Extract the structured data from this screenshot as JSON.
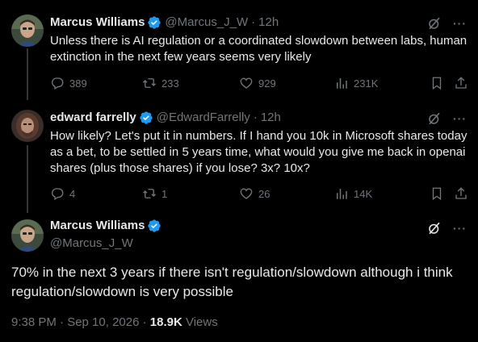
{
  "tweets": [
    {
      "name": "Marcus Williams",
      "handle": "@Marcus_J_W",
      "time": "12h",
      "text": "Unless there is AI regulation or a coordinated slowdown between labs, human extinction in the next few years seems very likely",
      "replies": "389",
      "reposts": "233",
      "likes": "929",
      "views": "231K"
    },
    {
      "name": "edward farrelly",
      "handle": "@EdwardFarrelly",
      "time": "12h",
      "text": "How likely? Let's put it in numbers. If I hand you 10k in Microsoft shares today as a bet, to be settled in 5 years time, what would you give me back in openai shares (plus those shares) if you lose? 3x? 10x?",
      "replies": "4",
      "reposts": "1",
      "likes": "26",
      "views": "14K"
    }
  ],
  "main": {
    "name": "Marcus Williams",
    "handle": "@Marcus_J_W",
    "text": "70% in the next 3 years if there isn't regulation/slowdown although i think regulation/slowdown is very possible",
    "timestamp": "9:38 PM · Sep 10, 2026 · ",
    "views_count": "18.9K",
    "views_label": " Views"
  },
  "separator_dot": "·",
  "more_label": "···",
  "colors": {
    "background": "#000000",
    "text": "#e7e9ea",
    "muted": "#71767b",
    "verified": "#1d9bf0"
  },
  "icons": [
    "verified-badge-icon",
    "grok-icon",
    "more-icon",
    "reply-icon",
    "repost-icon",
    "like-icon",
    "views-icon",
    "bookmark-icon",
    "share-icon"
  ]
}
